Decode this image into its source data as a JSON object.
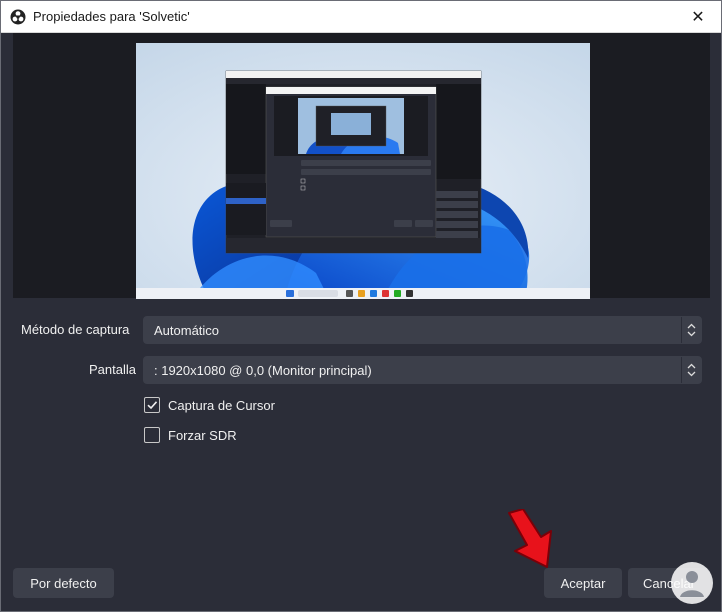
{
  "window": {
    "title": "Propiedades para 'Solvetic'",
    "close_glyph": "✕"
  },
  "form": {
    "capture_method_label": "Método de captura",
    "capture_method_value": "Automático",
    "display_label": "Pantalla",
    "display_value": ": 1920x1080 @ 0,0 (Monitor principal)",
    "capture_cursor_label": "Captura de Cursor",
    "capture_cursor_checked": true,
    "force_sdr_label": "Forzar SDR",
    "force_sdr_checked": false
  },
  "buttons": {
    "defaults": "Por defecto",
    "accept": "Aceptar",
    "cancel": "Cancelar"
  },
  "colors": {
    "dialog_bg": "#2b2d38",
    "control_bg": "#3c3f4a",
    "annotation_arrow": "#e8121b"
  },
  "icons": {
    "app": "obs-logo-icon",
    "annotation": "red-arrow-icon",
    "watermark": "solvetic-logo"
  }
}
